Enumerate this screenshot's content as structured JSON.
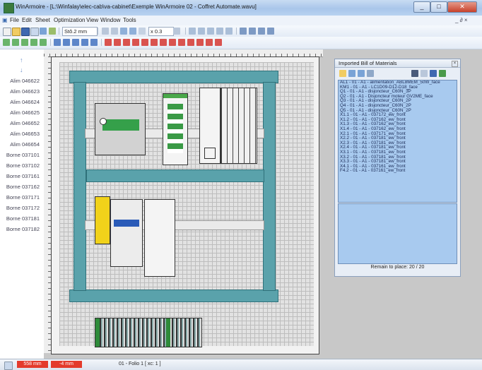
{
  "window": {
    "title": "WinArmoire - [L:\\Winfalay\\elec-cab\\va-cabinet\\Exemple WinArmoire 02 - Coffret Automate.wavu]",
    "controls": [
      "_",
      "□",
      "✕"
    ]
  },
  "menu": {
    "items": [
      "File",
      "Edit",
      "Sheet",
      "Optimization",
      "View",
      "Window",
      "Tools"
    ],
    "mdi_controls": "_ ∂ ×"
  },
  "toolbar": {
    "grid_value": "Stô.2 mm",
    "zoom_value": "x 0.3"
  },
  "left_panel": {
    "arrows": [
      "↑",
      "↓"
    ],
    "items": [
      "Alim 046622",
      "Alim 046623",
      "Alim 046624",
      "Alim 046625",
      "Alim 046652",
      "Alim 046653",
      "Alim 046654",
      "Borne 037101",
      "Borne 037102",
      "Borne 037161",
      "Borne 037162",
      "Borne 037171",
      "Borne 037172",
      "Borne 037181",
      "Borne 037182"
    ]
  },
  "bom": {
    "title": "Imported Bill of Materials",
    "close": "×",
    "items": [
      "AL1 - 01 - A1 - alimentation_ABL8MEM_50W_face",
      "KM1 - 01 - A1 - LC1D09-D12-D18_face",
      "Q1 - 01 - A1 - disjoncteur_C60N_3P",
      "Q2 - 01 - A1 - Disjoncteur moteur GV2ME_face",
      "Q3 - 01 - A1 - disjoncteur_C60N_2P",
      "Q4 - 01 - A1 - disjoncteur_C60N_2P",
      "Q5 - 01 - A1 - disjoncteur_C60N_2P",
      "X1.1 - 01 - A1 - 037172_ew_front",
      "X1.2 - 01 - A1 - 037162_ew_front",
      "X1.3 - 01 - A1 - 037162_ew_front",
      "X1.4 - 01 - A1 - 037162_ew_front",
      "X2.1 - 01 - A1 - 037171_ew_front",
      "X2.2 - 01 - A1 - 037181_ew_front",
      "X2.3 - 01 - A1 - 037181_ew_front",
      "X2.4 - 01 - A1 - 037181_ew_front",
      "X3.1 - 01 - A1 - 037181_ew_front",
      "X3.2 - 01 - A1 - 037181_ew_front",
      "X3.3 - 01 - A1 - 037181_ew_front",
      "X4.1 - 01 - A1 - 037161_ew_front",
      "F4.2 - 01 - A1 - 037161_ew_front"
    ],
    "remain": "Remain to place: 20 / 20"
  },
  "status": {
    "x": "558 mm",
    "y": "-4 mm",
    "folio": "01 - Folio 1 [ xc: 1 ]"
  },
  "colors": {
    "panel_teal": "#5aa2ab",
    "list_blue": "#a8caef",
    "status_red": "#e43b2c"
  }
}
